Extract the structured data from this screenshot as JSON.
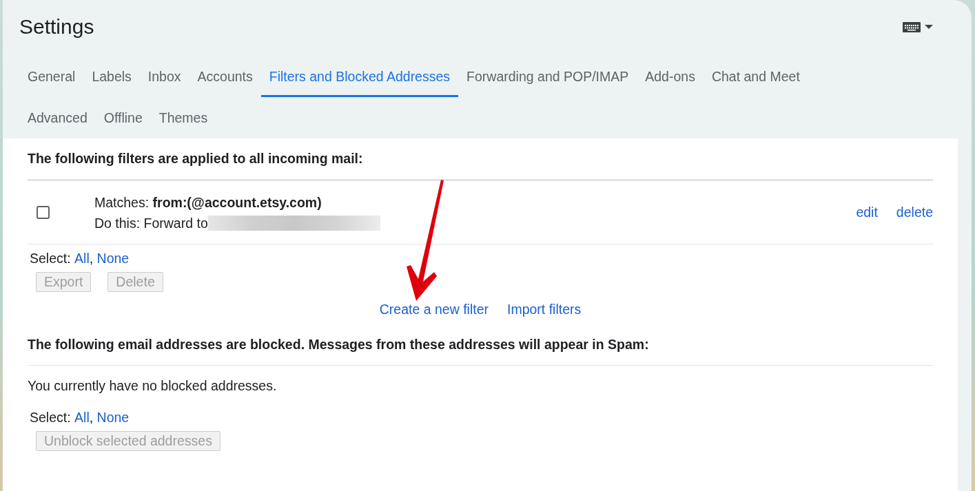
{
  "title": "Settings",
  "tab_rows": [
    [
      {
        "label": "General",
        "selected": false
      },
      {
        "label": "Labels",
        "selected": false
      },
      {
        "label": "Inbox",
        "selected": false
      },
      {
        "label": "Accounts",
        "selected": false
      },
      {
        "label": "Filters and Blocked Addresses",
        "selected": true
      },
      {
        "label": "Forwarding and POP/IMAP",
        "selected": false
      },
      {
        "label": "Add-ons",
        "selected": false
      },
      {
        "label": "Chat and Meet",
        "selected": false
      }
    ],
    [
      {
        "label": "Advanced",
        "selected": false
      },
      {
        "label": "Offline",
        "selected": false
      },
      {
        "label": "Themes",
        "selected": false
      }
    ]
  ],
  "filters": {
    "heading": "The following filters are applied to all incoming mail:",
    "rows": [
      {
        "checked": false,
        "matches": "Matches: **from:(@account.etsy.com)**",
        "action": "Do this: Forward to",
        "links": [
          "edit",
          "delete"
        ]
      }
    ],
    "select": {
      "label": "Select:",
      "links": [
        "All",
        "None"
      ],
      "separator": ","
    },
    "buttons": [
      {
        "label": "Export",
        "disabled": true
      },
      {
        "label": "Delete",
        "disabled": true
      }
    ],
    "links": [
      "Create a new filter",
      "Import filters"
    ]
  },
  "blocked": {
    "heading": "The following email addresses are blocked. Messages from these addresses will appear in Spam:",
    "empty": "You currently have no blocked addresses.",
    "select": {
      "label": "Select:",
      "links": [
        "All",
        "None"
      ],
      "separator": ","
    },
    "buttons": [
      {
        "label": "Unblock selected addresses",
        "disabled": true
      }
    ]
  }
}
